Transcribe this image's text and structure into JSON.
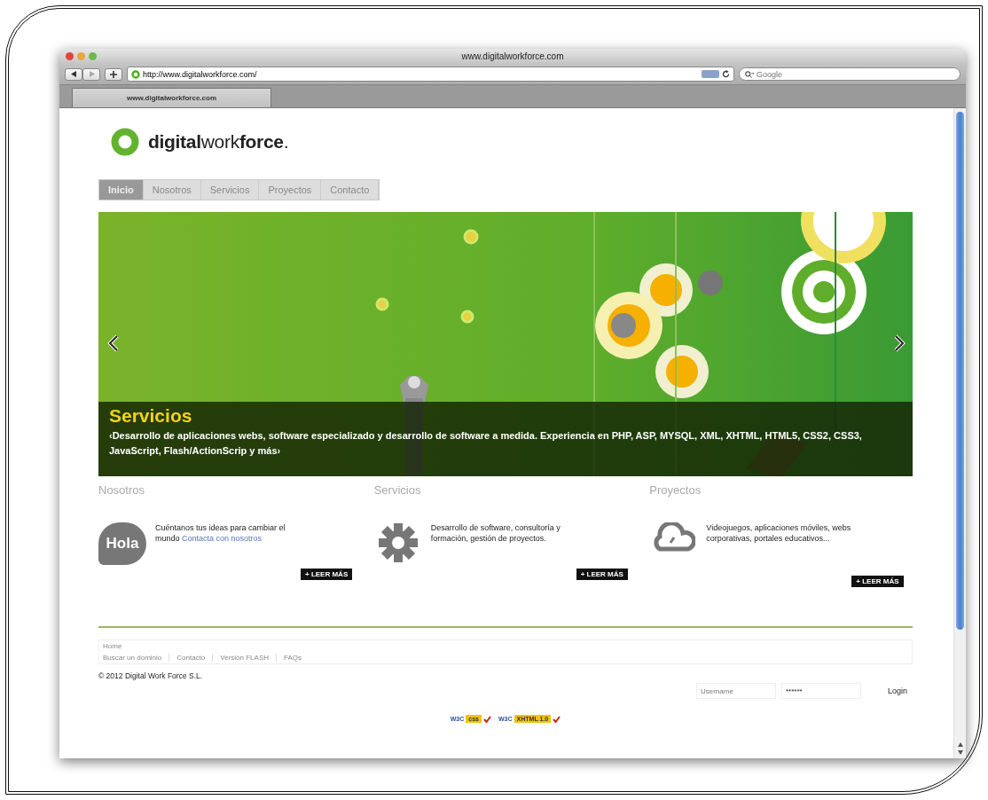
{
  "browser": {
    "title": "www.digitalworkforce.com",
    "url": "http://www.digitalworkforce.com/",
    "search_placeholder": "Google",
    "tabs": [
      {
        "label": "www.digitalworkforce.com",
        "selected": true
      }
    ]
  },
  "logo": "**digital**work**force**.",
  "nav": [
    {
      "label": "Inicio",
      "selected": true
    },
    {
      "label": "Nosotros",
      "selected": false
    },
    {
      "label": "Servicios",
      "selected": false
    },
    {
      "label": "Proyectos",
      "selected": false
    },
    {
      "label": "Contacto",
      "selected": false
    }
  ],
  "slider": {
    "title": "Servicios",
    "text": "‹Desarrollo de aplicaciones webs, software especializado y desarrollo de software a medida. Experiencia en PHP, ASP, MYSQL, XML, XHTML, HTML5, CSS2, CSS3, JavaScript, Flash/ActionScrip y más›"
  },
  "features": [
    {
      "heading": "Nosotros",
      "kind": "bubble",
      "icon_text": "Hola",
      "text": "Cuéntanos tus ideas para cambiar el mundo",
      "link": "Contacta con nosotros",
      "button": "+ LEER MÁS"
    },
    {
      "heading": "Servicios",
      "kind": "gear",
      "text": "Desarrollo de software, consultoría y formación, gestión de proyectos.",
      "button": "+ LEER MÁS"
    },
    {
      "heading": "Proyectos",
      "kind": "cloud",
      "text": "Videojuegos, aplicaciones móviles, webs corporativas, portales educativos...",
      "button": "+ LEER MÁS"
    }
  ],
  "footer": {
    "home": "Home",
    "links": [
      "Buscar un dominio",
      "Contacto",
      "Versión FLASH",
      "FAQs"
    ],
    "copyright": "© 2012 Digital Work Force S.L.",
    "username_placeholder": "Username",
    "password_value": "******",
    "login": "Login",
    "badges": [
      {
        "logo": "W3C",
        "label": "css"
      },
      {
        "logo": "W3C",
        "label": "XHTML 1.0"
      }
    ]
  }
}
